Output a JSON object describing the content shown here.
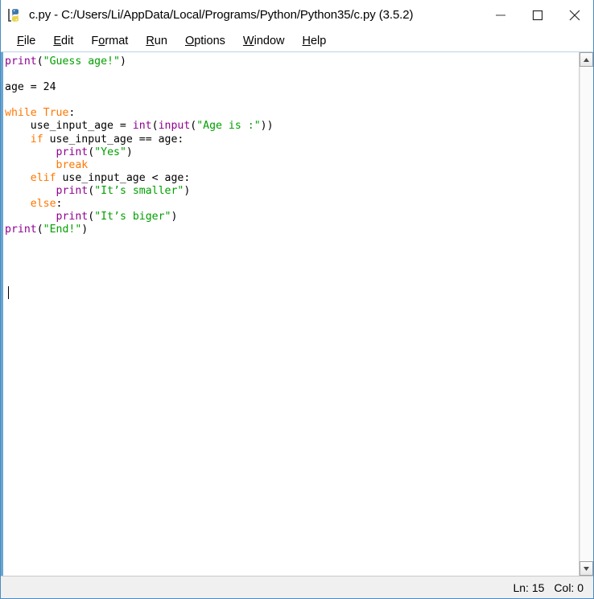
{
  "window": {
    "title": "c.py - C:/Users/Li/AppData/Local/Programs/Python/Python35/c.py (3.5.2)",
    "icon": "python-idle-icon",
    "border_color": "#4a8cc2",
    "controls": {
      "minimize": "minimize-icon",
      "maximize": "maximize-icon",
      "close": "close-icon"
    }
  },
  "menubar": {
    "items": [
      {
        "label": "File",
        "pre": "",
        "accel": "F",
        "post": "ile"
      },
      {
        "label": "Edit",
        "pre": "",
        "accel": "E",
        "post": "dit"
      },
      {
        "label": "Format",
        "pre": "F",
        "accel": "o",
        "post": "rmat"
      },
      {
        "label": "Run",
        "pre": "",
        "accel": "R",
        "post": "un"
      },
      {
        "label": "Options",
        "pre": "",
        "accel": "O",
        "post": "ptions"
      },
      {
        "label": "Window",
        "pre": "",
        "accel": "W",
        "post": "indow"
      },
      {
        "label": "Help",
        "pre": "",
        "accel": "H",
        "post": "elp"
      }
    ]
  },
  "editor": {
    "language": "python",
    "syntax_colors": {
      "keyword": "#ff7700",
      "builtin": "#900090",
      "string": "#00a000",
      "plain": "#000000"
    },
    "cursor": {
      "line": 15,
      "column": 0
    },
    "lines": [
      {
        "n": 1,
        "tokens": [
          {
            "t": "bi",
            "v": "print"
          },
          {
            "t": "plain",
            "v": "("
          },
          {
            "t": "str",
            "v": "\"Guess age!\""
          },
          {
            "t": "plain",
            "v": ")"
          }
        ]
      },
      {
        "n": 2,
        "tokens": []
      },
      {
        "n": 3,
        "tokens": [
          {
            "t": "plain",
            "v": "age = 24"
          }
        ]
      },
      {
        "n": 4,
        "tokens": []
      },
      {
        "n": 5,
        "tokens": [
          {
            "t": "kw",
            "v": "while"
          },
          {
            "t": "plain",
            "v": " "
          },
          {
            "t": "kw",
            "v": "True"
          },
          {
            "t": "plain",
            "v": ":"
          }
        ]
      },
      {
        "n": 6,
        "tokens": [
          {
            "t": "plain",
            "v": "    use_input_age = "
          },
          {
            "t": "bi",
            "v": "int"
          },
          {
            "t": "plain",
            "v": "("
          },
          {
            "t": "bi",
            "v": "input"
          },
          {
            "t": "plain",
            "v": "("
          },
          {
            "t": "str",
            "v": "\"Age is :\""
          },
          {
            "t": "plain",
            "v": "))"
          }
        ]
      },
      {
        "n": 7,
        "tokens": [
          {
            "t": "plain",
            "v": "    "
          },
          {
            "t": "kw",
            "v": "if"
          },
          {
            "t": "plain",
            "v": " use_input_age == age:"
          }
        ]
      },
      {
        "n": 8,
        "tokens": [
          {
            "t": "plain",
            "v": "        "
          },
          {
            "t": "bi",
            "v": "print"
          },
          {
            "t": "plain",
            "v": "("
          },
          {
            "t": "str",
            "v": "\"Yes\""
          },
          {
            "t": "plain",
            "v": ")"
          }
        ]
      },
      {
        "n": 9,
        "tokens": [
          {
            "t": "plain",
            "v": "        "
          },
          {
            "t": "kw",
            "v": "break"
          }
        ]
      },
      {
        "n": 10,
        "tokens": [
          {
            "t": "plain",
            "v": "    "
          },
          {
            "t": "kw",
            "v": "elif"
          },
          {
            "t": "plain",
            "v": " use_input_age < age:"
          }
        ]
      },
      {
        "n": 11,
        "tokens": [
          {
            "t": "plain",
            "v": "        "
          },
          {
            "t": "bi",
            "v": "print"
          },
          {
            "t": "plain",
            "v": "("
          },
          {
            "t": "str",
            "v": "\"It’s smaller\""
          },
          {
            "t": "plain",
            "v": ")"
          }
        ]
      },
      {
        "n": 12,
        "tokens": [
          {
            "t": "plain",
            "v": "    "
          },
          {
            "t": "kw",
            "v": "else"
          },
          {
            "t": "plain",
            "v": ":"
          }
        ]
      },
      {
        "n": 13,
        "tokens": [
          {
            "t": "plain",
            "v": "        "
          },
          {
            "t": "bi",
            "v": "print"
          },
          {
            "t": "plain",
            "v": "("
          },
          {
            "t": "str",
            "v": "\"It’s biger\""
          },
          {
            "t": "plain",
            "v": ")"
          }
        ]
      },
      {
        "n": 14,
        "tokens": [
          {
            "t": "bi",
            "v": "print"
          },
          {
            "t": "plain",
            "v": "("
          },
          {
            "t": "str",
            "v": "\"End!\""
          },
          {
            "t": "plain",
            "v": ")"
          }
        ]
      },
      {
        "n": 15,
        "tokens": []
      }
    ]
  },
  "scrollbar": {
    "up_arrow": "scroll-up-icon",
    "down_arrow": "scroll-down-icon"
  },
  "statusbar": {
    "line_label": "Ln: 15",
    "col_label": "Col: 0"
  }
}
